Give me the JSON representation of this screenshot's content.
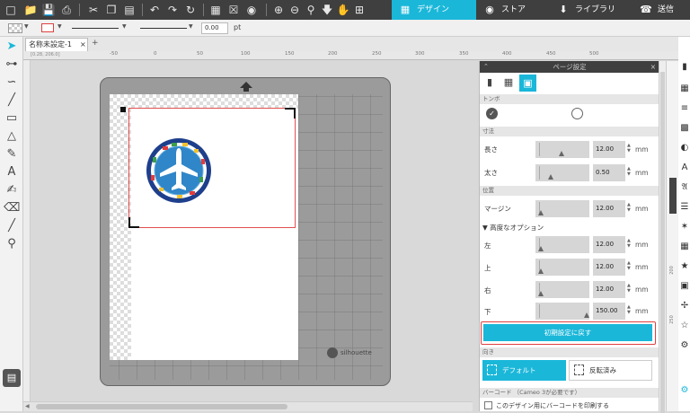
{
  "topbar": {
    "nav": {
      "design": "デザイン",
      "store": "ストア",
      "library": "ライブラリ",
      "send": "送信"
    },
    "colors": {
      "bar": "#3f3f3f",
      "active_tab": "#1ab7d9"
    }
  },
  "optbar": {
    "line_width": "0.00",
    "unit": "pt"
  },
  "doc_tab": {
    "name": "名称未設定-1",
    "close": "×",
    "add": "+"
  },
  "ruler_top": [
    "-50",
    "0",
    "50",
    "100",
    "150",
    "200",
    "250",
    "300",
    "350",
    "400",
    "450",
    "500"
  ],
  "ruler_small": "[0.28, 206.0]",
  "ruler_left": [
    "200",
    "250"
  ],
  "mat": {
    "brand": "silhouette"
  },
  "panel": {
    "title": "ページ設定",
    "close": "×",
    "sections": {
      "tombo": "トンボ",
      "size": "寸法",
      "position": "位置",
      "advanced": "高度なオプション",
      "orientation": "向き",
      "barcode": "バーコード （Cameo 3が必要です）"
    },
    "rows": {
      "length": {
        "label": "長さ",
        "value": "12.00",
        "unit": "mm"
      },
      "thickness": {
        "label": "太さ",
        "value": "0.50",
        "unit": "mm"
      },
      "margin": {
        "label": "マージン",
        "value": "12.00",
        "unit": "mm"
      },
      "left": {
        "label": "左",
        "value": "12.00",
        "unit": "mm"
      },
      "top": {
        "label": "上",
        "value": "12.00",
        "unit": "mm"
      },
      "right": {
        "label": "右",
        "value": "12.00",
        "unit": "mm"
      },
      "bottom": {
        "label": "下",
        "value": "150.00",
        "unit": "mm"
      }
    },
    "reset_button": "初期設定に戻す",
    "orientation": {
      "default": "デフォルト",
      "reversed": "反転済み"
    },
    "barcode_checkbox": "このデザイン用にバーコードを印刷する"
  }
}
